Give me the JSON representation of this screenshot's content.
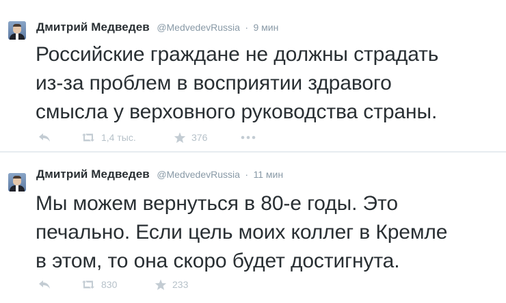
{
  "tweets": [
    {
      "author_name": "Дмитрий Медведев",
      "handle": "@MedvedevRussia",
      "separator": "·",
      "time": "9 мин",
      "lines": [
        "Российские граждане не должны страдать",
        "из-за проблем в восприятии здравого",
        "смысла у верховного руководства страны."
      ],
      "retweets": "1,4 тыс.",
      "favorites": "376"
    },
    {
      "author_name": "Дмитрий Медведев",
      "handle": "@MedvedevRussia",
      "separator": "·",
      "time": "11 мин",
      "lines": [
        "Мы можем вернуться в 80-е годы. Это",
        "печально. Если цель моих коллег в Кремле",
        "в этом, то она скоро будет достигнута."
      ],
      "retweets": "830",
      "favorites": "233"
    }
  ],
  "icons": {
    "reply": "reply-arrow-icon",
    "retweet": "retweet-icon",
    "favorite": "star-icon",
    "more": "more-dots-icon",
    "avatar": "avatar-icon"
  },
  "colors": {
    "text": "#292f33",
    "muted": "#8899a6",
    "action_icon": "#b6c1c9",
    "divider": "#e6ecf0"
  }
}
